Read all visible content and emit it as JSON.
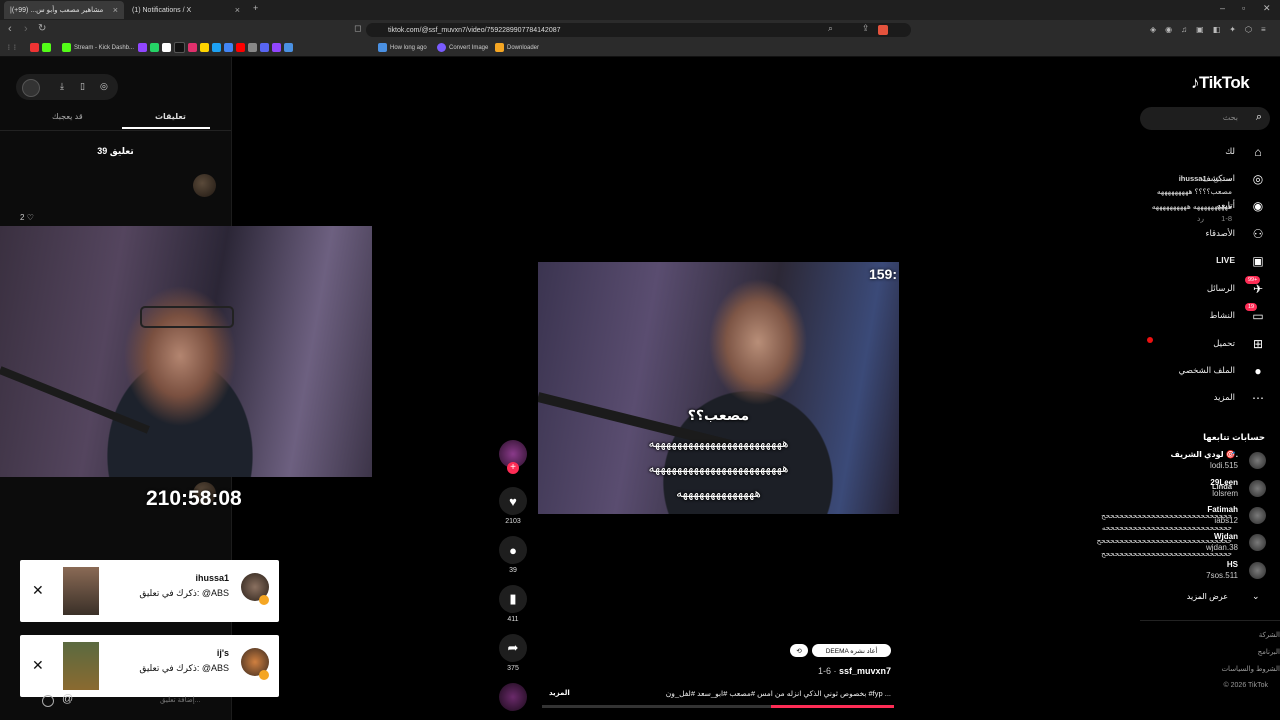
{
  "browser": {
    "tabs": [
      {
        "label": "|مشاهير مصعب وأبو س... (99+)"
      },
      {
        "label": "(1) Notifications / X"
      }
    ],
    "url": "tiktok.com/@ssf_muvxn7/video/7592289907784142087",
    "bookmarks": [
      "Stream - Kick Dashb...",
      "How long ago",
      "Convert Image",
      "Downloader"
    ]
  },
  "comments": {
    "tab_comments": "تعليقات",
    "tab_liked": "قد يعجبك",
    "count_label": "39 تعليق",
    "first": {
      "user": "ihussa1",
      "relation": "· صديق",
      "line1": "مصعب؟؟؟؟ هههههههههه",
      "line2": "ههههههههههه ههههههههههه",
      "date": "1-8",
      "reply": "رد",
      "likes": "2"
    },
    "linda": {
      "user": "Linda",
      "line1": "ححححححححححححححححححححححححححححح",
      "line2": "ححححححححححححححححححححححححححححه",
      "line3": "حححححححححححححححححححححححححححححح",
      "line4": "ححححححححححححححححححححححححححححح"
    },
    "add_placeholder": "إضافة تعليق..."
  },
  "overlay": {
    "clock": "210:58:08",
    "timer": "159:"
  },
  "notifications": [
    {
      "name": "ihussa1",
      "message": "ذكرك في تعليق: @ABS"
    },
    {
      "name": "ij's",
      "message": "ذكرك في تعليق: @ABS"
    }
  ],
  "video": {
    "hook_title": "مصعب؟؟",
    "hook_line1": "ههههههههههههههههههههههههه",
    "hook_line2": "ههههههههههههههههههههههههه",
    "hook_line3": "ههههههههههههههه"
  },
  "actions": {
    "likes": "2103",
    "comments": "39",
    "saves": "411",
    "shares": "375"
  },
  "post": {
    "repost_chip": "DEEMA أعاد نشره",
    "author": "ssf_muvxn7",
    "date": "1-6 ·",
    "caption": "بخصوص ثوني الذكي انزله من امس #مصعب #ابو_سعد #لفل_ون #fyp ...",
    "more": "المزيد",
    "progress": 0.35
  },
  "sidebar": {
    "logo": "TikTok",
    "search_placeholder": "بحث",
    "menu": [
      {
        "label": "لك",
        "icon": "home-icon"
      },
      {
        "label": "استكشف",
        "icon": "compass-icon"
      },
      {
        "label": "أتابعه",
        "icon": "following-icon"
      },
      {
        "label": "الأصدقاء",
        "icon": "friends-icon"
      },
      {
        "label": "LIVE",
        "icon": "live-icon"
      },
      {
        "label": "الرسائل",
        "icon": "message-icon",
        "badge": "99+"
      },
      {
        "label": "النشاط",
        "icon": "activity-icon",
        "badge": "19"
      },
      {
        "label": "تحميل",
        "icon": "upload-icon"
      },
      {
        "label": "الملف الشخصي",
        "icon": "profile-icon"
      },
      {
        "label": "المزيد",
        "icon": "more-icon"
      }
    ],
    "following_title": "حسابات تتابعها",
    "following": [
      {
        "name": "لودي الشريف 🎯.",
        "user": "lodi.515"
      },
      {
        "name": "29Leen",
        "user": "lolsrem"
      },
      {
        "name": "Fatimah",
        "user": "iabs12"
      },
      {
        "name": "Wjdan",
        "user": "wjdan.38"
      },
      {
        "name": "HS",
        "user": "7sos.511"
      }
    ],
    "see_more": "عرض المزيد",
    "footer": [
      "الشركة",
      "البرنامج",
      "الشروط والسياسات",
      "© 2026 TikTok"
    ]
  },
  "colors": {
    "accent": "#fe2c55",
    "badge": "#f5a623"
  }
}
